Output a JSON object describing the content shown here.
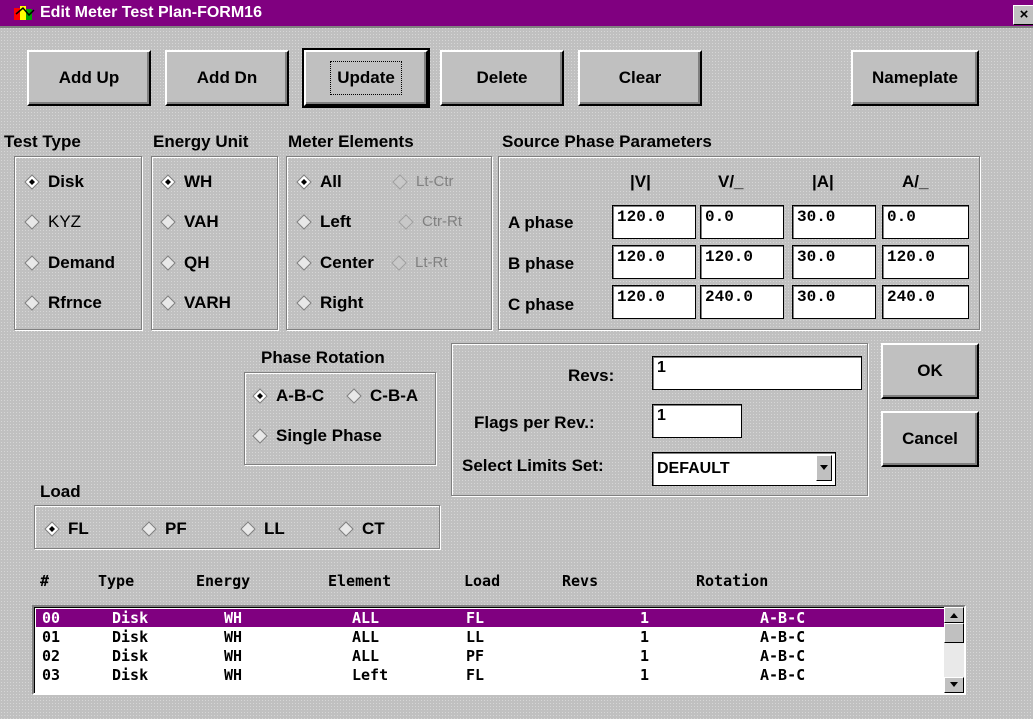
{
  "window": {
    "title": "Edit Meter Test Plan-FORM16",
    "close_glyph": "×"
  },
  "toolbar": {
    "add_up": "Add Up",
    "add_dn": "Add Dn",
    "update": "Update",
    "delete": "Delete",
    "clear": "Clear",
    "nameplate": "Nameplate"
  },
  "test_type": {
    "title": "Test Type",
    "options": [
      "Disk",
      "KYZ",
      "Demand",
      "Rfrnce"
    ],
    "selected": "Disk"
  },
  "energy_unit": {
    "title": "Energy Unit",
    "options": [
      "WH",
      "VAH",
      "QH",
      "VARH"
    ],
    "selected": "WH"
  },
  "meter_elements": {
    "title": "Meter Elements",
    "options": [
      "All",
      "Left",
      "Center",
      "Right"
    ],
    "disabled_options": [
      "Lt-Ctr",
      "Ctr-Rt",
      "Lt-Rt"
    ],
    "selected": "All"
  },
  "source_phase": {
    "title": "Source Phase Parameters",
    "col_v_mag": "|V|",
    "col_v_ang": "V/_",
    "col_a_mag": "|A|",
    "col_a_ang": "A/_",
    "rows": [
      {
        "label": "A phase",
        "v_mag": "120.0",
        "v_ang": "0.0",
        "a_mag": "30.0",
        "a_ang": "0.0"
      },
      {
        "label": "B phase",
        "v_mag": "120.0",
        "v_ang": "120.0",
        "a_mag": "30.0",
        "a_ang": "120.0"
      },
      {
        "label": "C phase",
        "v_mag": "120.0",
        "v_ang": "240.0",
        "a_mag": "30.0",
        "a_ang": "240.0"
      }
    ]
  },
  "phase_rotation": {
    "title": "Phase Rotation",
    "abc": "A-B-C",
    "cba": "C-B-A",
    "single": "Single Phase",
    "selected": "A-B-C"
  },
  "settings": {
    "revs_label": "Revs:",
    "revs_value": "1",
    "flags_label": "Flags per Rev.:",
    "flags_value": "1",
    "limits_label": "Select Limits Set:",
    "limits_value": "DEFAULT"
  },
  "dialog": {
    "ok": "OK",
    "cancel": "Cancel"
  },
  "load": {
    "title": "Load",
    "options": [
      "FL",
      "PF",
      "LL",
      "CT"
    ],
    "selected": "FL"
  },
  "test_list": {
    "headers": [
      "#",
      "Type",
      "Energy",
      "Element",
      "Load",
      "Revs",
      "Rotation"
    ],
    "rows": [
      [
        "00",
        "Disk",
        "WH",
        "ALL",
        "FL",
        "1",
        "A-B-C"
      ],
      [
        "01",
        "Disk",
        "WH",
        "ALL",
        "LL",
        "1",
        "A-B-C"
      ],
      [
        "02",
        "Disk",
        "WH",
        "ALL",
        "PF",
        "1",
        "A-B-C"
      ],
      [
        "03",
        "Disk",
        "WH",
        "Left",
        "FL",
        "1",
        "A-B-C"
      ]
    ],
    "selected_row": 0
  },
  "colors": {
    "titlebar": "#800080",
    "selection": "#800080",
    "face": "#c0c0c0"
  }
}
